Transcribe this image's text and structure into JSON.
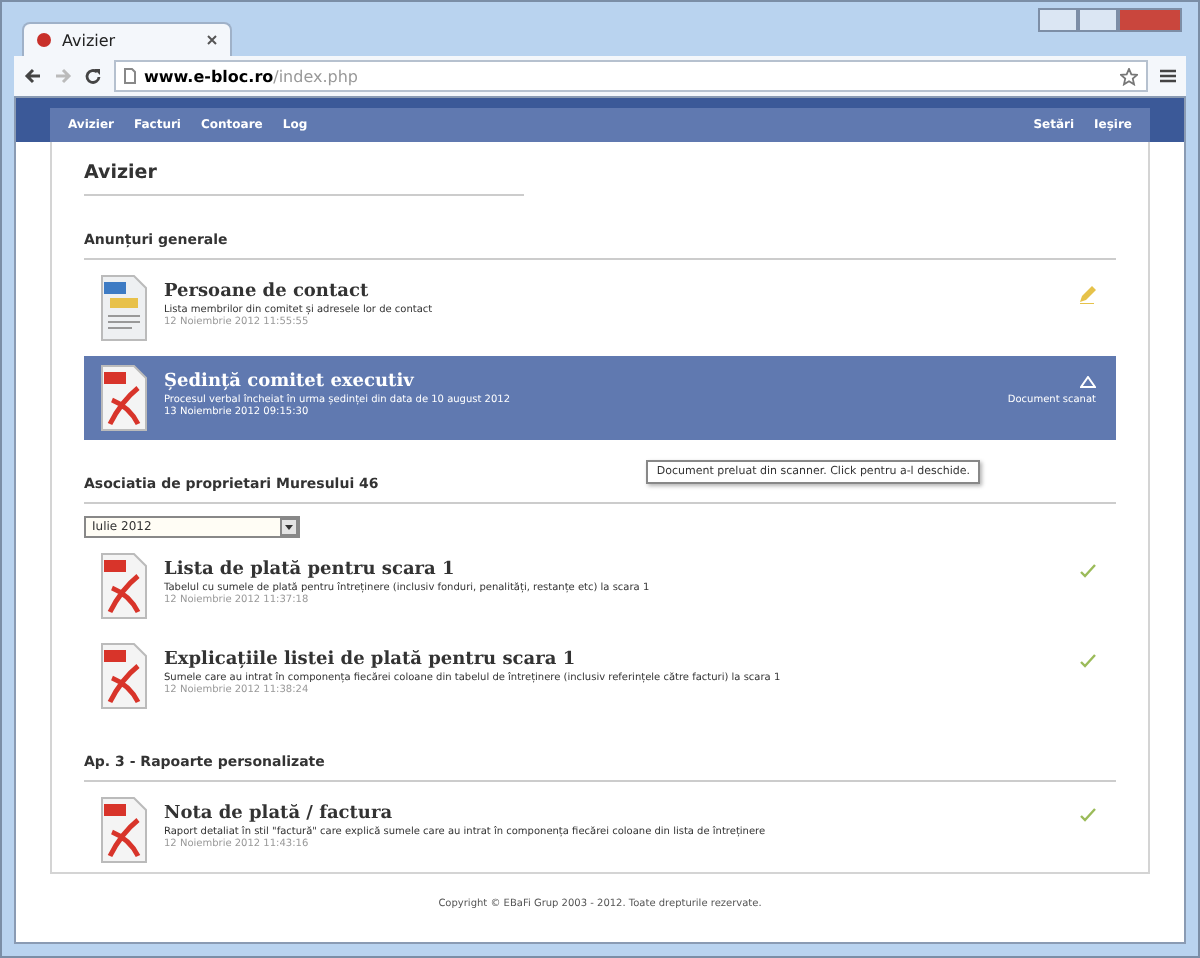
{
  "browser": {
    "tab_title": "Avizier",
    "url_domain": "www.e-bloc.ro",
    "url_path": "/index.php"
  },
  "nav": {
    "left": [
      "Avizier",
      "Facturi",
      "Contoare",
      "Log"
    ],
    "right": [
      "Setări",
      "Ieșire"
    ]
  },
  "page_title": "Avizier",
  "sections": [
    {
      "heading": "Anunțuri generale",
      "items": [
        {
          "title": "Persoane de contact",
          "description": "Lista membrilor din comitet și adresele lor de contact",
          "date": "12 Noiembrie 2012 11:55:55",
          "file_icon": {
            "kind": "doc"
          },
          "status_icon": {
            "kind": "edit"
          },
          "selected": false
        },
        {
          "title": "Ședință comitet executiv",
          "description": "Procesul verbal încheiat în urma ședinței din data de 10 august 2012",
          "date": "13 Noiembrie 2012 09:15:30",
          "file_icon": {
            "kind": "pdf"
          },
          "status_icon": {
            "kind": "scan"
          },
          "status_label": "Document scanat",
          "selected": true,
          "tooltip": "Document preluat din scanner. Click pentru a-l deschide."
        }
      ]
    },
    {
      "heading": "Asociatia de proprietari Muresului 46",
      "select": "Iulie 2012",
      "items": [
        {
          "title": "Lista de plată pentru scara 1",
          "description": "Tabelul cu sumele de plată pentru întreținere (inclusiv fonduri, penalități, restanțe etc) la scara 1",
          "date": "12 Noiembrie 2012 11:37:18",
          "file_icon": {
            "kind": "pdf"
          },
          "status_icon": {
            "kind": "check"
          },
          "selected": false
        },
        {
          "title": "Explicațiile listei de plată pentru scara 1",
          "description": "Sumele care au intrat în componența fiecărei coloane din tabelul de întreținere (inclusiv referințele către facturi) la scara 1",
          "date": "12 Noiembrie 2012 11:38:24",
          "file_icon": {
            "kind": "pdf"
          },
          "status_icon": {
            "kind": "check"
          },
          "selected": false
        }
      ]
    },
    {
      "heading": "Ap. 3 - Rapoarte personalizate",
      "items": [
        {
          "title": "Nota de plată / factura",
          "description": "Raport detaliat în stil \"factură\" care explică sumele care au intrat în componența fiecărei coloane din lista de întreținere",
          "date": "12 Noiembrie 2012 11:43:16",
          "file_icon": {
            "kind": "pdf"
          },
          "status_icon": {
            "kind": "check"
          },
          "selected": false
        }
      ]
    }
  ],
  "footer": "Copyright © EBaFi Grup 2003 - 2012. Toate drepturile rezervate."
}
